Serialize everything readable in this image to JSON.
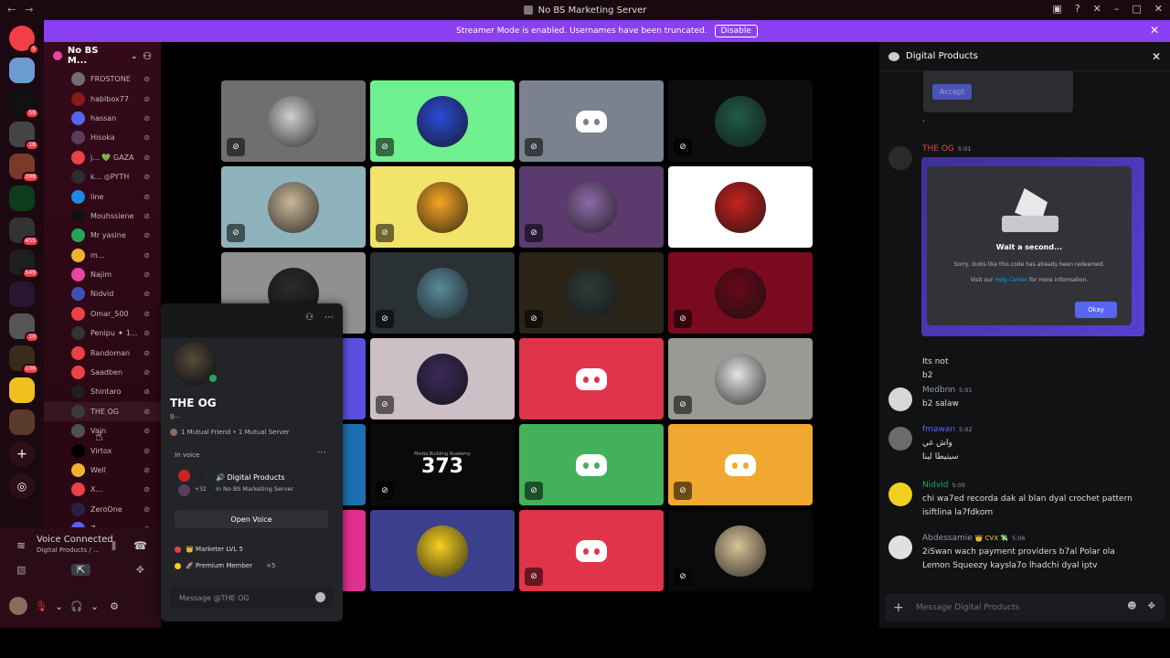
{
  "window": {
    "title": "No BS Marketing Server"
  },
  "banner": {
    "text": "Streamer Mode is enabled. Usernames have been truncated.",
    "disable": "Disable"
  },
  "guild_badges": [
    "5",
    "59",
    "18",
    "398",
    "455",
    "549",
    "10",
    "106"
  ],
  "server": {
    "name": "No BS M..."
  },
  "members": [
    {
      "name": "FROSTONE",
      "color": "#6f6f6f"
    },
    {
      "name": "hablbox77",
      "color": "#8b1a1a"
    },
    {
      "name": "hassan",
      "color": "#5865f2",
      "extra": "hassan ◎"
    },
    {
      "name": "Hisoka",
      "color": "#5a3d5c"
    },
    {
      "name": "j... 💚 GAZA",
      "color": "#ed4245"
    },
    {
      "name": "k... ◎PYTH",
      "color": "#2b2d31"
    },
    {
      "name": "line",
      "color": "#1e88e5"
    },
    {
      "name": "Mouhssiene",
      "color": "#111111"
    },
    {
      "name": "Mr yasine",
      "color": "#23a55a"
    },
    {
      "name": "m...",
      "color": "#f0b232"
    },
    {
      "name": "Najim",
      "color": "#eb459e"
    },
    {
      "name": "Nidvid",
      "color": "#3f51b5"
    },
    {
      "name": "Omar_500",
      "color": "#ed4245"
    },
    {
      "name": "Penipu ✦ 1...",
      "color": "#333333"
    },
    {
      "name": "Randoman",
      "color": "#ed4245"
    },
    {
      "name": "Saadben",
      "color": "#ed4245"
    },
    {
      "name": "Shintaro",
      "color": "#1e1f22"
    },
    {
      "name": "THE OG",
      "color": "#3a3a3a"
    },
    {
      "name": "Vain",
      "color": "#4e5058"
    },
    {
      "name": "Virtox",
      "color": "#000000"
    },
    {
      "name": "Well",
      "color": "#f0b232"
    },
    {
      "name": "X...",
      "color": "#ed4245"
    },
    {
      "name": "ZeroOne",
      "color": "#2b1f4a"
    },
    {
      "name": "Z...",
      "color": "#5865f2"
    }
  ],
  "voice": {
    "title": "Voice Connected",
    "sub": "Digital Products / ..."
  },
  "tiles": [
    {
      "bg": "#6f6f6f",
      "av": "#cfcfcf",
      "type": "avatar",
      "muted": true
    },
    {
      "bg": "#6ef08e",
      "av": "#2d4bd6",
      "type": "avatar",
      "muted": true
    },
    {
      "bg": "#7b818f",
      "av": "",
      "type": "discord",
      "muted": true
    },
    {
      "bg": "#0d0d0d",
      "av": "#1f5c4a",
      "type": "avatar",
      "muted": true
    },
    {
      "bg": "#8fb3bd",
      "av": "#c9b79a",
      "type": "avatar",
      "muted": true
    },
    {
      "bg": "#f2e36a",
      "av": "#f5a623",
      "type": "avatar",
      "muted": true
    },
    {
      "bg": "#5b3a6e",
      "av": "#8e6aa6",
      "type": "avatar",
      "muted": true
    },
    {
      "bg": "#ffffff",
      "av": "#c7221f",
      "type": "avatar",
      "muted": false
    },
    {
      "bg": "#909090",
      "av": "#2a2a2a",
      "type": "avatar",
      "muted": false
    },
    {
      "bg": "#2a3134",
      "av": "#5a8a9a",
      "type": "avatar",
      "muted": true
    },
    {
      "bg": "#2a2418",
      "av": "#2f3b3a",
      "type": "avatar",
      "muted": true
    },
    {
      "bg": "#7a0a1e",
      "av": "#6a0818",
      "type": "avatar",
      "muted": true
    },
    {
      "bg": "#5a4fe0",
      "av": "",
      "type": "blank",
      "muted": false
    },
    {
      "bg": "#cdbfc6",
      "av": "#3a2a5a",
      "type": "avatar",
      "muted": true
    },
    {
      "bg": "#e0344a",
      "av": "",
      "type": "discord",
      "muted": false
    },
    {
      "bg": "#9a9a94",
      "av": "#e4e4e4",
      "type": "avatar",
      "muted": true
    },
    {
      "bg": "#1c6fb0",
      "av": "",
      "type": "blank",
      "muted": false
    },
    {
      "bg": "#0a0a0a",
      "av": "",
      "type": "373",
      "muted": true
    },
    {
      "bg": "#43b05c",
      "av": "",
      "type": "discord",
      "muted": true
    },
    {
      "bg": "#f0a830",
      "av": "",
      "type": "discord",
      "muted": true
    },
    {
      "bg": "#e03090",
      "av": "",
      "type": "blank",
      "muted": false
    },
    {
      "bg": "#3c3f8e",
      "av": "#f5d020",
      "type": "avatar",
      "muted": false
    },
    {
      "bg": "#e0344a",
      "av": "",
      "type": "discord",
      "muted": true
    },
    {
      "bg": "#0a0a0a",
      "av": "#d9c49a",
      "type": "avatar",
      "muted": true
    }
  ],
  "tile_373": {
    "big": "373",
    "small": "Media Building Academy"
  },
  "popout": {
    "name": "THE OG",
    "tag": "g...",
    "mutual": "1 Mutual Friend • 1 Mutual Server",
    "in_voice": "In voice",
    "channel": "🔊 Digital Products",
    "server": "in No BS Marketing Server",
    "plus_count": "+32",
    "open_voice": "Open Voice",
    "roles": [
      {
        "label": "👑 Marketer LVL 5",
        "color": "#ed4245"
      },
      {
        "label": "🚀 Premium Member",
        "color": "#f0d020",
        "more": "+5"
      }
    ],
    "message_placeholder": "Message @THE OG"
  },
  "right_panel": {
    "title": "Digital Products",
    "accept": "Accept",
    "dot": ".",
    "messages": [
      {
        "author": "THE OG",
        "ts": "5:01",
        "color": "#ed4245",
        "lines": []
      },
      {
        "author": "",
        "ts": "",
        "color": "",
        "lines": [
          "Its not",
          "b2"
        ]
      },
      {
        "author": "Medbnn",
        "ts": "5:01",
        "color": "#949ba4",
        "lines": [
          "b2 salaw"
        ]
      },
      {
        "author": "fmawan",
        "ts": "5:02",
        "color": "#5865f2",
        "lines": [
          "واش غي",
          "سيتيطا لينا"
        ]
      },
      {
        "author": "Nidvid",
        "ts": "5:05",
        "color": "#23a55a",
        "lines": [
          "chi wa7ed recorda dak al blan dyal crochet pattern",
          "isiftlina la7fdkom"
        ]
      },
      {
        "author": "Abdessamie",
        "ts": "5:06",
        "color": "#949ba4",
        "badge": "👑 CVX 💸",
        "lines": [
          "2iSwan wach payment providers b7al Polar ola",
          "Lemon Squeezy kaysla7o lhadchi dyal iptv"
        ]
      }
    ],
    "embed": {
      "title": "Wait a second...",
      "line1": "Sorry, looks like this code has already been redeemed.",
      "line2_a": "Visit our",
      "line2_link": "Help Center",
      "line2_b": "for more information.",
      "okay": "Okay"
    },
    "input_placeholder": "Message Digital Products"
  }
}
